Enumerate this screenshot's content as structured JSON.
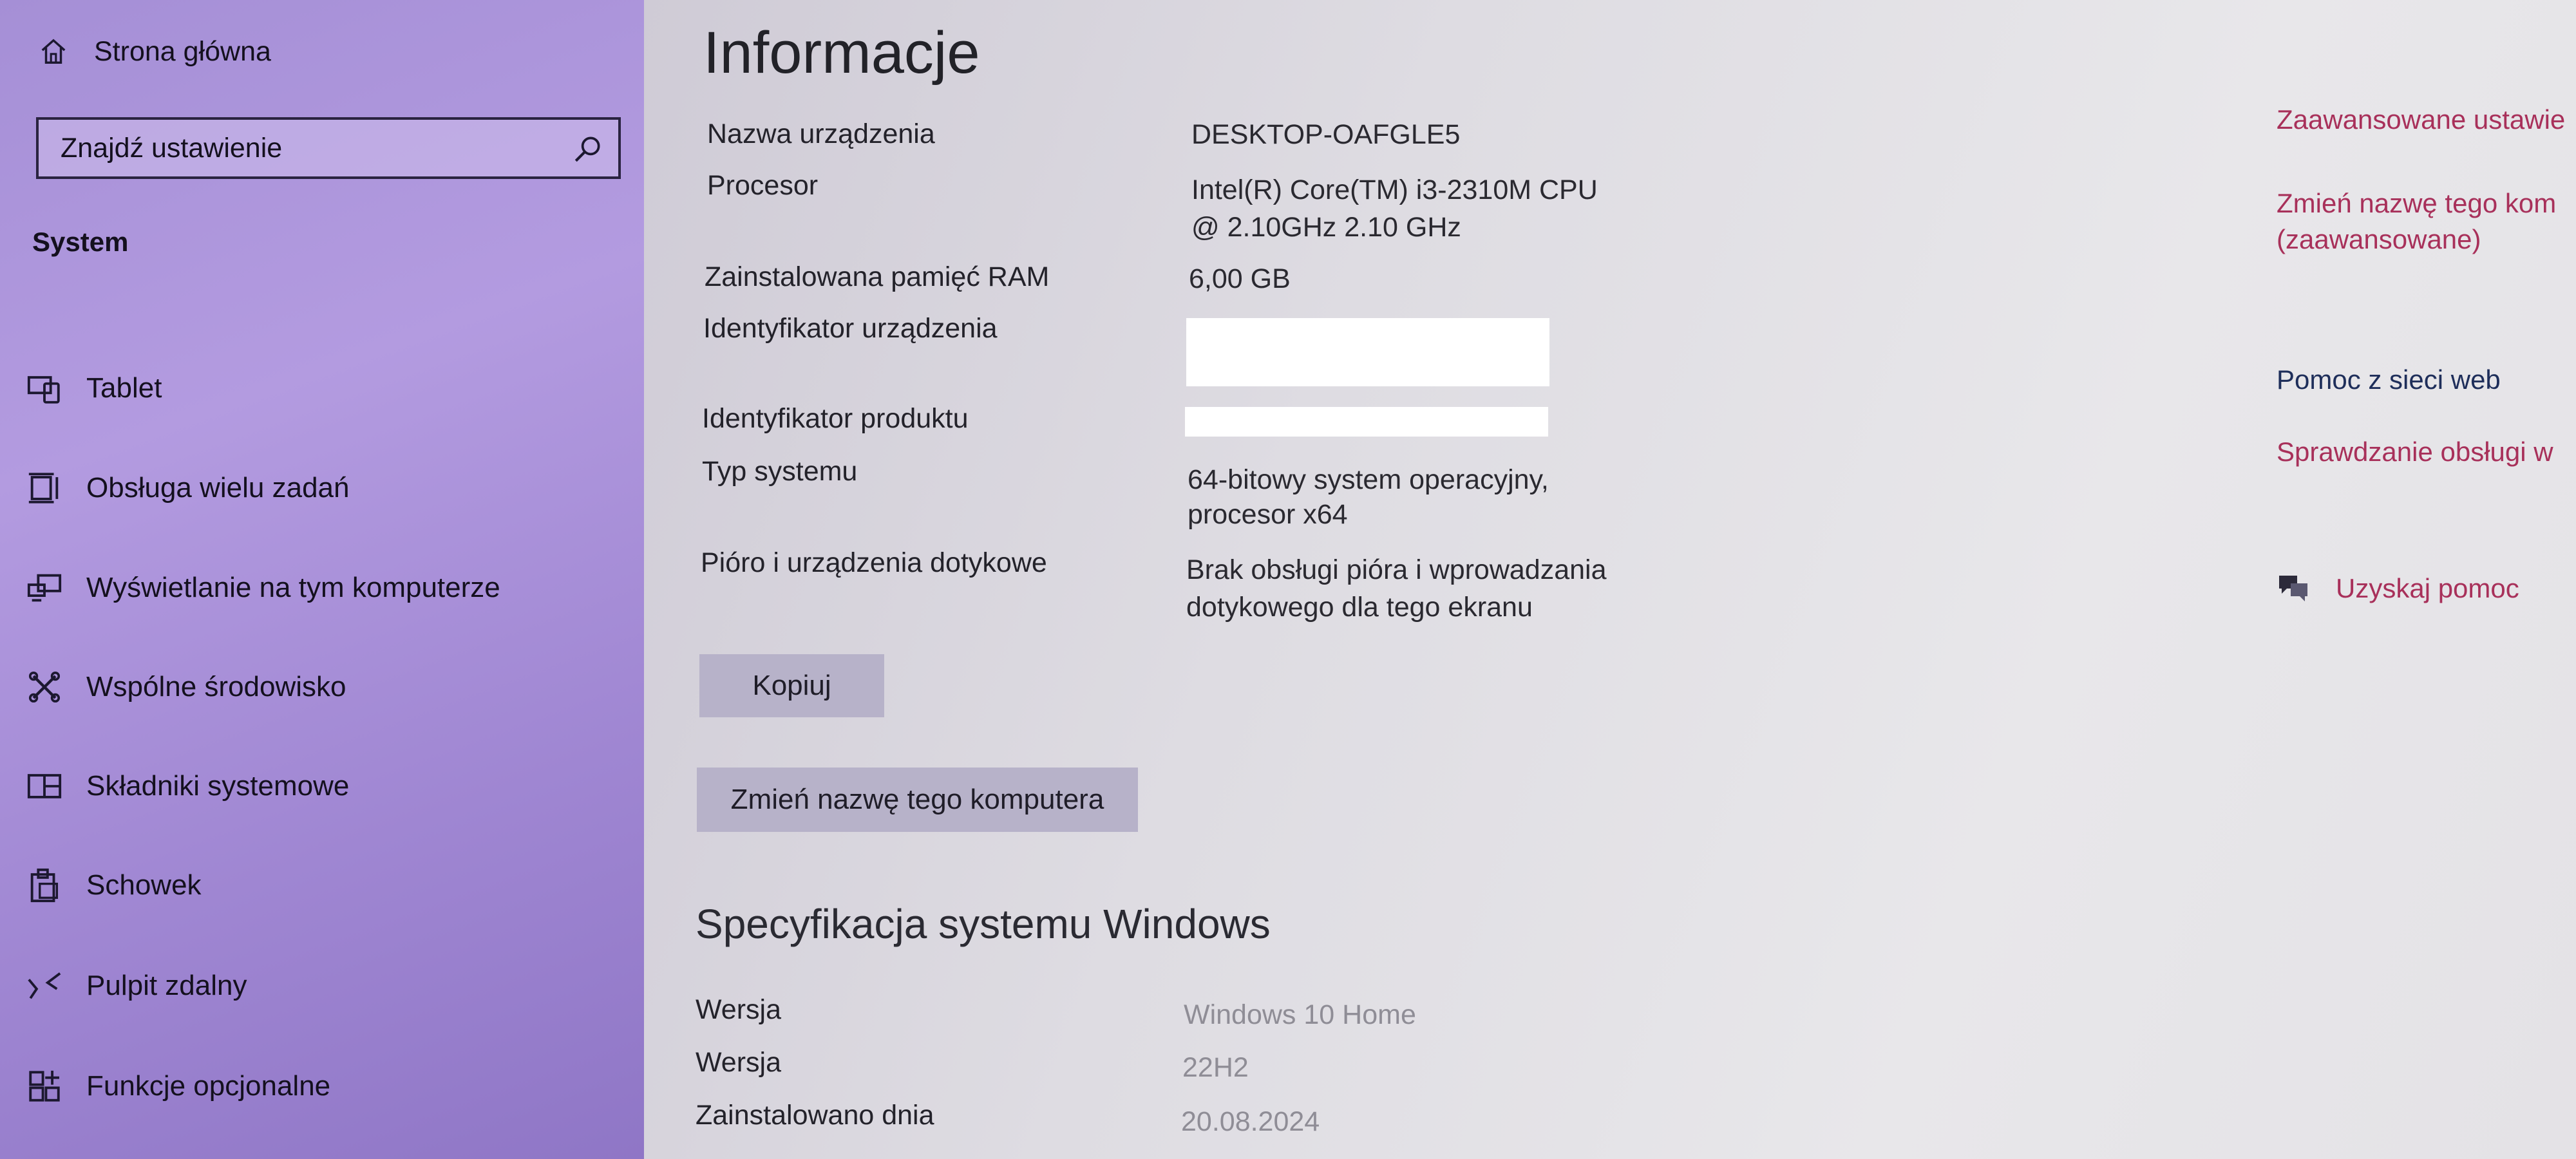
{
  "sidebar": {
    "home_label": "Strona główna",
    "search_placeholder": "Znajdź ustawienie",
    "section_title": "System",
    "items": [
      {
        "label": "Tablet",
        "icon": "tablet-icon"
      },
      {
        "label": "Obsługa wielu zadań",
        "icon": "multitasking-icon"
      },
      {
        "label": "Wyświetlanie na tym komputerze",
        "icon": "project-icon"
      },
      {
        "label": "Wspólne środowisko",
        "icon": "shared-experiences-icon"
      },
      {
        "label": "Składniki systemowe",
        "icon": "system-components-icon"
      },
      {
        "label": "Schowek",
        "icon": "clipboard-icon"
      },
      {
        "label": "Pulpit zdalny",
        "icon": "remote-desktop-icon"
      },
      {
        "label": "Funkcje opcjonalne",
        "icon": "optional-features-icon"
      }
    ]
  },
  "main": {
    "title": "Informacje",
    "specs": {
      "device_name_label": "Nazwa urządzenia",
      "device_name_value": "DESKTOP-OAFGLE5",
      "processor_label": "Procesor",
      "processor_value_line1": "Intel(R) Core(TM) i3-2310M CPU",
      "processor_value_line2": "@ 2.10GHz   2.10 GHz",
      "ram_label": "Zainstalowana pamięć RAM",
      "ram_value": "6,00 GB",
      "device_id_label": "Identyfikator urządzenia",
      "product_id_label": "Identyfikator produktu",
      "system_type_label": "Typ systemu",
      "system_type_line1": "64-bitowy system operacyjny,",
      "system_type_line2": "procesor x64",
      "pen_label": "Pióro i urządzenia dotykowe",
      "pen_line1": "Brak obsługi pióra i wprowadzania",
      "pen_line2": "dotykowego dla tego ekranu"
    },
    "copy_button": "Kopiuj",
    "rename_button": "Zmień nazwę tego komputera",
    "windows_spec": {
      "title": "Specyfikacja systemu Windows",
      "edition_label": "Wersja",
      "edition_value": "Windows 10 Home",
      "version_label": "Wersja",
      "version_value": "22H2",
      "installed_label": "Zainstalowano dnia",
      "installed_value": "20.08.2024"
    }
  },
  "related": {
    "advanced_settings": "Zaawansowane ustawie",
    "rename_advanced_line1": "Zmień nazwę tego kom",
    "rename_advanced_line2": "(zaawansowane)",
    "web_help_title": "Pomoc z sieci web",
    "check_support": "Sprawdzanie obsługi w",
    "get_help": "Uzyskaj pomoc"
  },
  "colors": {
    "sidebar_accent": "#a58fd6",
    "link": "#a8305a",
    "button": "#b7b2c9"
  }
}
